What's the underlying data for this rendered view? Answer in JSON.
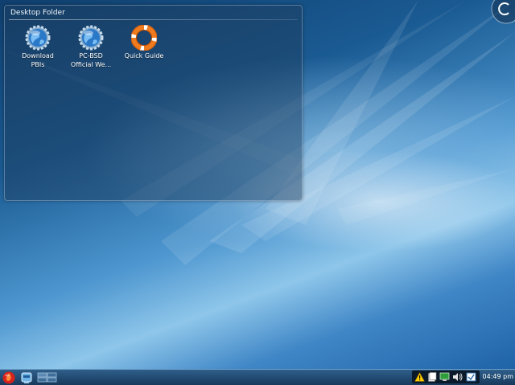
{
  "desktop_folder": {
    "title": "Desktop Folder",
    "items": [
      {
        "label_line1": "Download",
        "label_line2": "PBIs",
        "icon": "globe-gear-icon"
      },
      {
        "label_line1": "PC-BSD",
        "label_line2": "Official We...",
        "icon": "globe-gear-icon"
      },
      {
        "label_line1": "Quick Guide",
        "label_line2": "",
        "icon": "lifebuoy-icon"
      }
    ]
  },
  "taskbar": {
    "start_icon": "pcbsd-flame-icon",
    "launchers": [
      "dolphin-file-manager-icon",
      "virtual-desktop-pager-icon"
    ],
    "tray_icons": [
      "warning-icon",
      "clipboard-icon",
      "network-monitor-icon",
      "volume-icon",
      "update-manager-icon"
    ],
    "clock": "04:49 pm"
  },
  "colors": {
    "accent": "#3f86c6",
    "taskbar": "#1e4670"
  }
}
